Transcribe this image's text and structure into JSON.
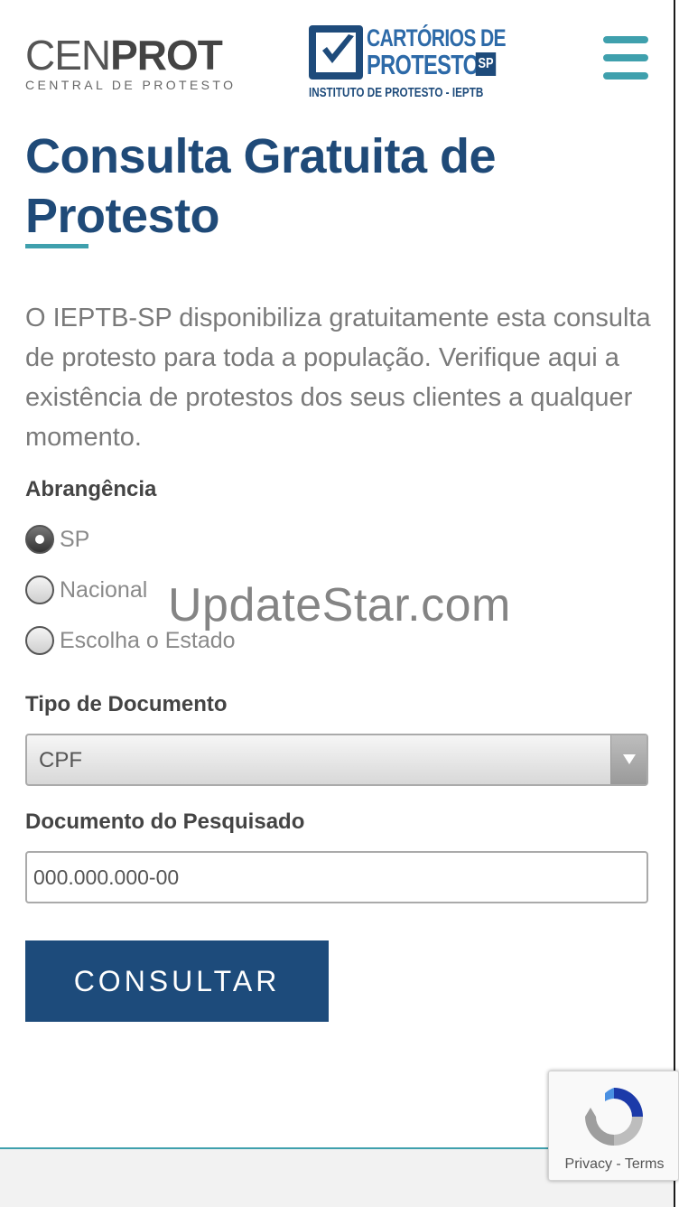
{
  "header": {
    "cenprot_logo": {
      "cen": "CEN",
      "prot": "PROT",
      "subtitle": "CENTRAL DE PROTESTO"
    },
    "cartorios_logo": {
      "line1": "CARTÓRIOS DE",
      "line2": "PROTESTO",
      "badge": "SP",
      "line3": "INSTITUTO DE PROTESTO - IEPTB"
    },
    "menu_icon": "hamburger-menu-icon"
  },
  "main": {
    "title": "Consulta Gratuita de Protesto",
    "intro": "O IEPTB-SP disponibiliza gratuitamente esta consulta de protesto para toda a população. Verifique aqui a existência de protestos dos seus clientes a qualquer momento.",
    "abrangencia": {
      "label": "Abrangência",
      "options": [
        {
          "label": "SP",
          "checked": true
        },
        {
          "label": "Nacional",
          "checked": false
        },
        {
          "label": "Escolha o Estado",
          "checked": false
        }
      ]
    },
    "tipo_documento": {
      "label": "Tipo de Documento",
      "selected": "CPF"
    },
    "documento": {
      "label": "Documento do Pesquisado",
      "placeholder": "000.000.000-00"
    },
    "submit_label": "CONSULTAR"
  },
  "watermark": "UpdateStar.com",
  "recaptcha": {
    "privacy": "Privacy",
    "separator": "-",
    "terms": "Terms"
  },
  "colors": {
    "brand_blue": "#1f4a78",
    "accent_teal": "#3fa0ad",
    "button_blue": "#1d4b7b"
  }
}
